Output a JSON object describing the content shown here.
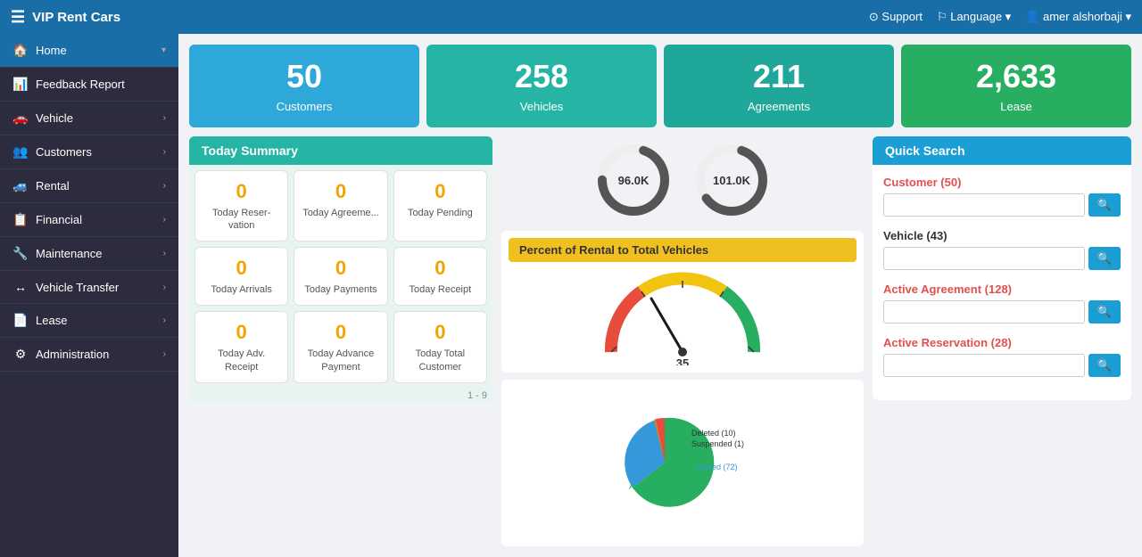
{
  "app": {
    "title": "VIP Rent Cars",
    "hamburger": "☰"
  },
  "topnav": {
    "support": "⊙ Support",
    "language": "⚐ Language ▾",
    "user": "👤 amer alshorbaji ▾"
  },
  "sidebar": {
    "items": [
      {
        "id": "home",
        "label": "Home",
        "icon": "🏠",
        "active": true,
        "chevron": "▾"
      },
      {
        "id": "feedback",
        "label": "Feedback Report",
        "icon": "📊",
        "active": false,
        "chevron": ""
      },
      {
        "id": "vehicle",
        "label": "Vehicle",
        "icon": "🚗",
        "active": false,
        "chevron": "›"
      },
      {
        "id": "customers",
        "label": "Customers",
        "icon": "👥",
        "active": false,
        "chevron": "›"
      },
      {
        "id": "rental",
        "label": "Rental",
        "icon": "🚙",
        "active": false,
        "chevron": "›"
      },
      {
        "id": "financial",
        "label": "Financial",
        "icon": "📋",
        "active": false,
        "chevron": "›"
      },
      {
        "id": "maintenance",
        "label": "Maintenance",
        "icon": "🔧",
        "active": false,
        "chevron": "›"
      },
      {
        "id": "vehicle-transfer",
        "label": "Vehicle Transfer",
        "icon": "↔",
        "active": false,
        "chevron": "›"
      },
      {
        "id": "lease",
        "label": "Lease",
        "icon": "📄",
        "active": false,
        "chevron": "›"
      },
      {
        "id": "administration",
        "label": "Administration",
        "icon": "⚙",
        "active": false,
        "chevron": "›"
      }
    ]
  },
  "stats": [
    {
      "num": "50",
      "label": "Customers",
      "color": "blue"
    },
    {
      "num": "258",
      "label": "Vehicles",
      "color": "teal"
    },
    {
      "num": "211",
      "label": "Agreements",
      "color": "teal2"
    },
    {
      "num": "2,633",
      "label": "Lease",
      "color": "green"
    }
  ],
  "today_summary": {
    "header": "Today Summary",
    "cards": [
      {
        "num": "0",
        "label": "Today Reser-vation"
      },
      {
        "num": "0",
        "label": "Today Agreeme..."
      },
      {
        "num": "0",
        "label": "Today Pending"
      },
      {
        "num": "0",
        "label": "Today Arrivals"
      },
      {
        "num": "0",
        "label": "Today Payments"
      },
      {
        "num": "0",
        "label": "Today Receipt"
      },
      {
        "num": "0",
        "label": "Today Adv. Receipt"
      },
      {
        "num": "0",
        "label": "Today Advance Payment"
      },
      {
        "num": "0",
        "label": "Today Total Customer"
      }
    ],
    "page_indicator": "1 - 9"
  },
  "donuts": [
    {
      "value": "96.0K",
      "percent": 70
    },
    {
      "value": "101.0K",
      "percent": 60
    }
  ],
  "gauge": {
    "header": "Percent of Rental to Total Vehicles",
    "value": "35"
  },
  "pie": {
    "segments": [
      {
        "label": "Active (128)",
        "value": 128,
        "color": "#27ae60"
      },
      {
        "label": "Closed (72)",
        "value": 72,
        "color": "#3498db"
      },
      {
        "label": "Deleted (10)",
        "value": 10,
        "color": "#e74c3c"
      },
      {
        "label": "Suspended (1)",
        "value": 1,
        "color": "#e67e22"
      }
    ]
  },
  "quick_search": {
    "header": "Quick Search",
    "items": [
      {
        "title": "Customer (50)",
        "color": "red",
        "placeholder": ""
      },
      {
        "title": "Vehicle (43)",
        "color": "black",
        "placeholder": ""
      },
      {
        "title": "Active Agreement (128)",
        "color": "red",
        "placeholder": ""
      },
      {
        "title": "Active Reservation (28)",
        "color": "red",
        "placeholder": ""
      }
    ]
  }
}
